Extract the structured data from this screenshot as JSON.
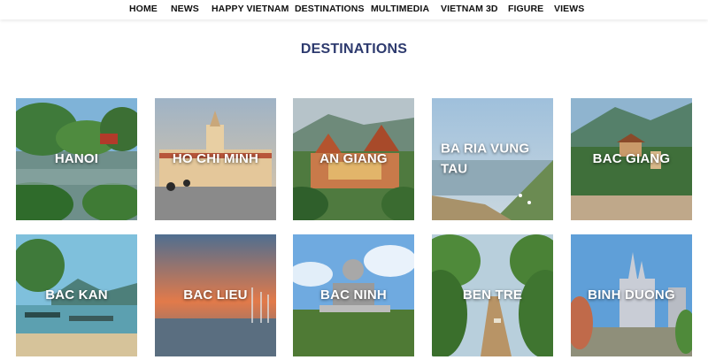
{
  "nav": {
    "items": [
      "HOME",
      "NEWS",
      "HAPPY VIETNAM",
      "DESTINATIONS",
      "MULTIMEDIA",
      "VIETNAM 3D",
      "FIGURE",
      "VIEWS"
    ]
  },
  "page": {
    "title": "DESTINATIONS"
  },
  "destinations": [
    {
      "name": "HANOI"
    },
    {
      "name": "HO CHI MINH"
    },
    {
      "name": "AN GIANG"
    },
    {
      "name": "BA RIA VUNG TAU"
    },
    {
      "name": "BAC GIANG"
    },
    {
      "name": "BAC KAN"
    },
    {
      "name": "BAC LIEU"
    },
    {
      "name": "BAC NINH"
    },
    {
      "name": "BEN TRE"
    },
    {
      "name": "BINH DUONG"
    }
  ],
  "colors": {
    "title": "#2d3a6e",
    "nav_text": "#111111"
  }
}
